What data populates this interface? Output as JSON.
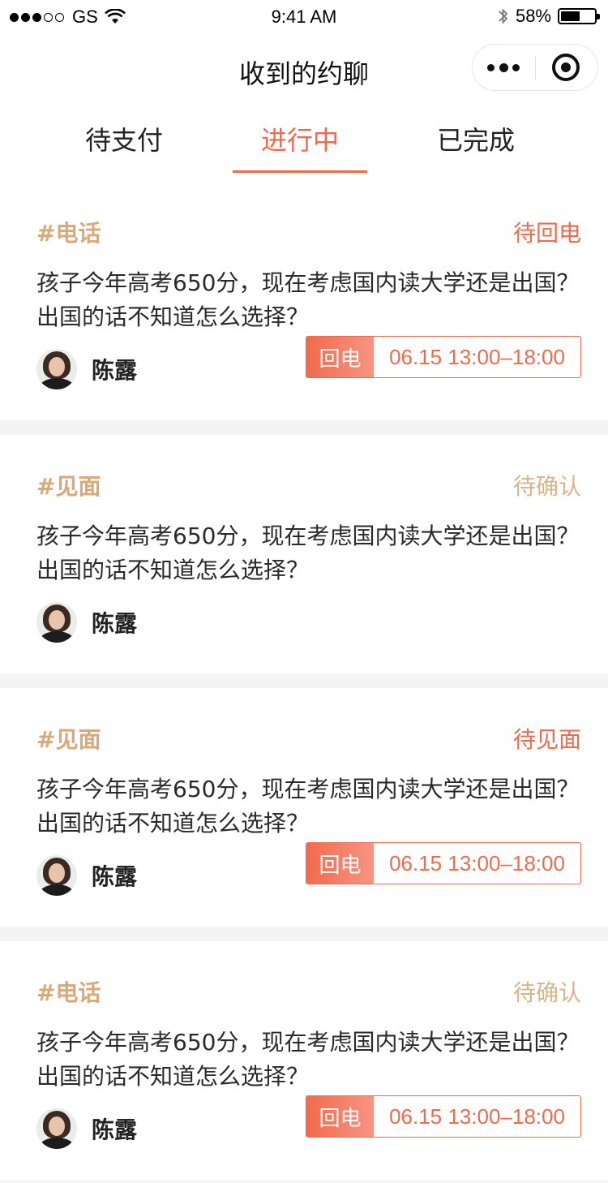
{
  "status_bar": {
    "carrier": "GS",
    "time": "9:41 AM",
    "battery": "58%",
    "battery_level": 0.58
  },
  "nav": {
    "title": "收到的约聊"
  },
  "tabs": [
    {
      "label": "待支付",
      "active": false
    },
    {
      "label": "进行中",
      "active": true
    },
    {
      "label": "已完成",
      "active": false
    }
  ],
  "colors": {
    "accent": "#f0694a",
    "type_tag": "#d8a979",
    "status_pending_confirm": "#d8b48a"
  },
  "cards": [
    {
      "type": "#电话",
      "status": "待回电",
      "status_color": "red",
      "text": "孩子今年高考650分，现在考虑国内读大学还是出国？出国的话不知道怎么选择？",
      "user": "陈露",
      "callback_label": "回电",
      "time_range": "06.15 13:00–18:00"
    },
    {
      "type": "#见面",
      "status": "待确认",
      "status_color": "gold",
      "text": "孩子今年高考650分，现在考虑国内读大学还是出国？出国的话不知道怎么选择？",
      "user": "陈露"
    },
    {
      "type": "#见面",
      "status": "待见面",
      "status_color": "red",
      "text": "孩子今年高考650分，现在考虑国内读大学还是出国？出国的话不知道怎么选择？",
      "user": "陈露",
      "callback_label": "回电",
      "time_range": "06.15 13:00–18:00"
    },
    {
      "type": "#电话",
      "status": "待确认",
      "status_color": "gold",
      "text": "孩子今年高考650分，现在考虑国内读大学还是出国？出国的话不知道怎么选择？",
      "user": "陈露",
      "callback_label": "回电",
      "time_range": "06.15 13:00–18:00"
    }
  ]
}
